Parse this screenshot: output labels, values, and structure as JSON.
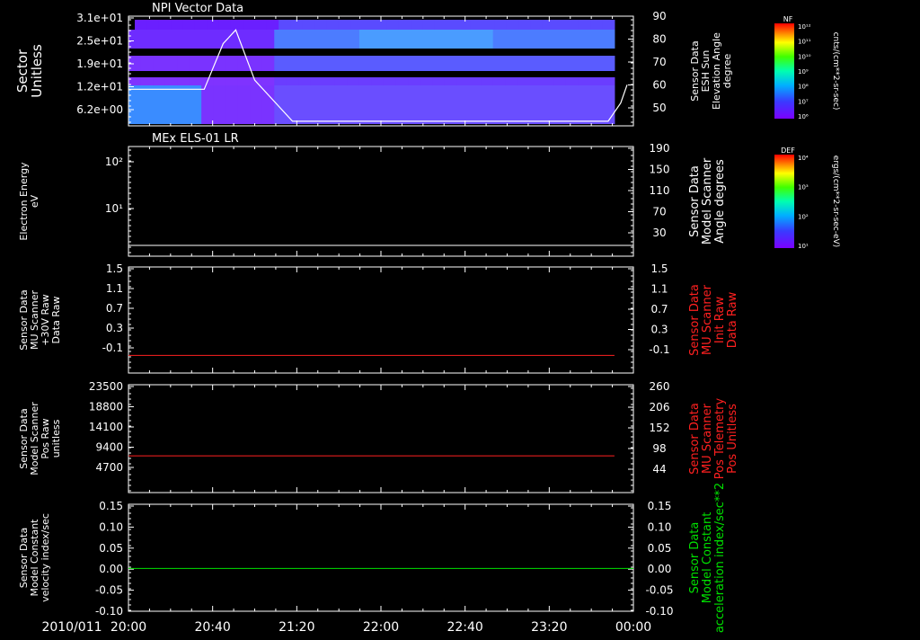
{
  "colors": {
    "background": "#000000",
    "foreground": "#ffffff",
    "red_series": "#ff2020",
    "green_series": "#00e000",
    "spectrogram_low": "#7b2cff",
    "spectrogram_high": "#ff1010"
  },
  "time_axis": {
    "date_label": "2010/011",
    "ticks": [
      "20:00",
      "20:40",
      "21:20",
      "22:00",
      "22:40",
      "23:20",
      "00:00"
    ]
  },
  "colorbars": [
    {
      "title": "NF",
      "unit": "cnts/(cm**2-sr-sec)",
      "tick_labels": [
        "10¹²",
        "10¹¹",
        "10¹⁰",
        "10⁹",
        "10⁸",
        "10⁷",
        "10⁶"
      ]
    },
    {
      "title": "DEF",
      "unit": "ergs/(cm**2-sr-sec-eV)",
      "tick_labels": [
        "10⁴",
        "10³",
        "10²",
        "10¹"
      ]
    }
  ],
  "chart_data": [
    {
      "type": "heatmap",
      "title": "NPI Vector Data",
      "ylabel": "Sector Unitless",
      "y_tick_labels": [
        "3.1e+01",
        "2.5e+01",
        "1.9e+01",
        "1.2e+01",
        "6.2e+00"
      ],
      "right_ylabel": "Sensor Data ESH Sun Elevation Angle degree",
      "right_tick_labels": [
        "90",
        "80",
        "70",
        "60",
        "50"
      ],
      "right_ylim": [
        42,
        90
      ],
      "overlay_line": {
        "color": "#ffffff",
        "x_hours": [
          0,
          0.6,
          0.75,
          0.85,
          1.0,
          1.3,
          1.6,
          3.8,
          3.9,
          3.95
        ],
        "y": [
          58,
          58,
          78,
          84,
          62,
          44,
          44,
          44,
          52,
          60
        ]
      }
    },
    {
      "type": "line",
      "title": "MEx ELS-01 LR",
      "ylabel": "Electron Energy eV",
      "y_tick_labels": [
        "10²",
        "10¹"
      ],
      "right_ylabel": "Sensor Data Model Scanner Angle degrees",
      "right_tick_labels": [
        "190",
        "150",
        "110",
        "70",
        "30"
      ],
      "right_ylim": [
        5,
        190
      ],
      "series": [
        {
          "color": "#ffffff",
          "x_hours": [
            0,
            4
          ],
          "y": [
            10,
            10
          ]
        }
      ]
    },
    {
      "type": "line",
      "ylabel": "Sensor Data MU Scanner +30V Raw Data Raw",
      "y_tick_labels": [
        "1.5",
        "1.1",
        "0.7",
        "0.3",
        "-0.1"
      ],
      "ylim": [
        -0.3,
        1.5
      ],
      "right_ylabel": "Sensor Data MU Scanner Init Raw Data Raw",
      "right_tick_labels": [
        "1.5",
        "1.1",
        "0.7",
        "0.3",
        "-0.1"
      ],
      "series": [
        {
          "color": "#ff2020",
          "x_hours": [
            0,
            3.85
          ],
          "y": [
            0,
            0
          ]
        }
      ]
    },
    {
      "type": "line",
      "ylabel": "Sensor Data Model Scanner Pos Raw unitless",
      "y_tick_labels": [
        "23500",
        "18800",
        "14100",
        "9400",
        "4700"
      ],
      "ylim": [
        0,
        23500
      ],
      "right_ylabel": "Sensor Data MU Scanner Pos Telemetry Pos Unitless",
      "right_tick_labels": [
        "260",
        "206",
        "152",
        "98",
        "44"
      ],
      "series": [
        {
          "color": "#ff2020",
          "x_hours": [
            0,
            3.85
          ],
          "y": [
            8000,
            8000
          ]
        }
      ]
    },
    {
      "type": "line",
      "ylabel": "Sensor Data Model Constant velocity index/sec",
      "y_tick_labels": [
        "0.15",
        "0.10",
        "0.05",
        "0.00",
        "-0.05",
        "-0.10"
      ],
      "ylim": [
        -0.1,
        0.15
      ],
      "right_ylabel": "Sensor Data Model Constant acceleration index/sec**2",
      "right_tick_labels": [
        "0.15",
        "0.10",
        "0.05",
        "0.00",
        "-0.05",
        "-0.10"
      ],
      "series": [
        {
          "color": "#00e000",
          "x_hours": [
            0,
            4
          ],
          "y": [
            0,
            0
          ]
        }
      ]
    }
  ]
}
